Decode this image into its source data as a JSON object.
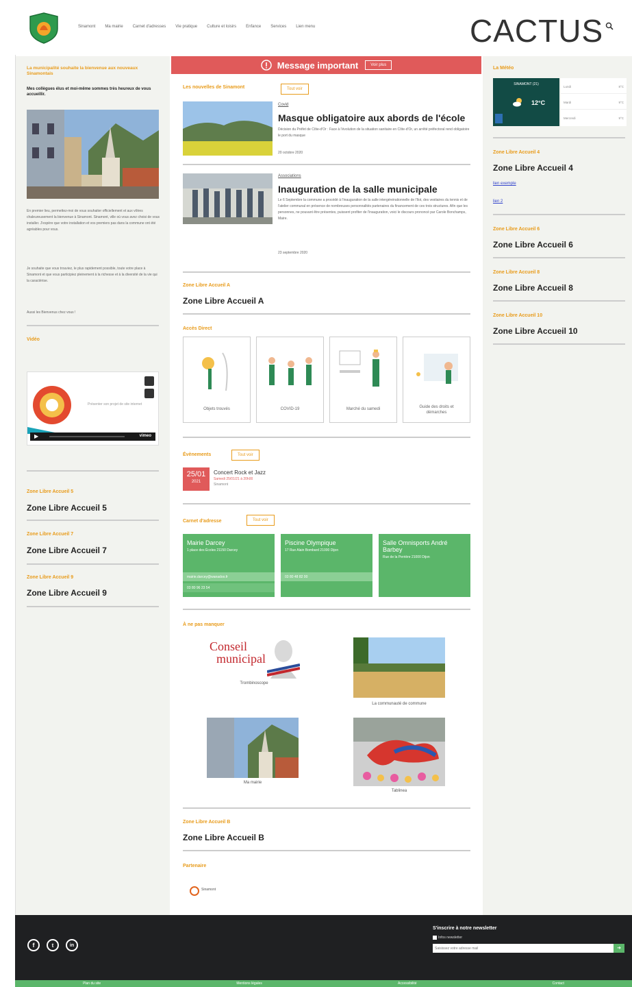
{
  "header": {
    "brand": "CACTUS",
    "nav": [
      "Sinamont",
      "Ma mairie",
      "Carnet d'adresses",
      "Vie pratique",
      "Culture et loisirs",
      "Enfance",
      "Services",
      "Lien menu"
    ]
  },
  "left": {
    "heading": "La municipalité souhaite la bienvenue aux nouveaux Sinamontais",
    "intro": "Mes collègues élus et moi-même sommes très heureux de vous accueillir.",
    "p1": "En premier lieu, permettez-moi de vous souhaiter officiellement et aux vôtres chaleureusement la bienvenue à Sinamont. Sinamont, ville où vous avez choisi de vous installer. J'espère que votre installation et vos premiers pas dans la commune ont été agréables pour vous.",
    "p2": "Je souhaite que vous trouviez, le plus rapidement possible, toute votre place à Sinamont et que vous participiez pleinement à la richesse et à la diversité de la vie qui la caractérise.",
    "p3": "Aussi les Bienvenus chez vous !",
    "video_heading": "Vidéo",
    "video_caption": "Présenter son projet de site internet",
    "zones": [
      {
        "small": "Zone Libre Accueil 5",
        "big": "Zone Libre Accueil 5"
      },
      {
        "small": "Zone Libre Accueil 7",
        "big": "Zone Libre Accueil 7"
      },
      {
        "small": "Zone Libre Accueil 9",
        "big": "Zone Libre Accueil 9"
      }
    ]
  },
  "main": {
    "important_title": "Message important",
    "important_btn": "Voir plus",
    "news_heading": "Les nouvelles de Sinamont",
    "news_btn": "Tout voir",
    "news": [
      {
        "cat": "Covid",
        "title": "Masque obligatoire aux abords de l'école",
        "text": "Décision du Préfet de Côte-d'Or : Face à l'évolution de la situation sanitaire en Côte-d'Or, un arrêté préfectoral rend obligatoire le port du masque",
        "date": "20 octobre 2020"
      },
      {
        "cat": "Associations",
        "title": "Inauguration de la salle municipale",
        "text": "Le 6 Septembre la commune a procédé à l'inauguration de la salle intergénérationnelle de l'Ilot, des vestiaires du tennis et de l'atelier communal en présence de nombreuses personnalités partenaires du financement de ces trois structures. Afin que les personnes, ne pouvant être présentes, puissent profiter de l'inauguration, voici le discours prononcé par Carole Bonchamps, Maire.",
        "date": "23 septembre 2020"
      }
    ],
    "zoneA_small": "Zone Libre Accueil A",
    "zoneA_big": "Zone Libre Accueil A",
    "direct_heading": "Accès Direct",
    "direct": [
      "Objets trouvés",
      "COVID-19",
      "Marché du samedi",
      "Guide des droits et démarches"
    ],
    "events_heading": "Évènements",
    "events_btn": "Tout voir",
    "event": {
      "day": "25/01",
      "year": "2021",
      "title": "Concert Rock et Jazz",
      "time": "Samedi 25/01/21 à 20h00",
      "place": "Sinamont"
    },
    "address_heading": "Carnet d'adresse",
    "address_btn": "Tout voir",
    "addresses": [
      {
        "name": "Mairie Darcey",
        "detail": "1 place des Écoles 21150 Darcey",
        "mail": "mairie.darcey@wanadoo.fr",
        "phone": "03 80 96 23 54"
      },
      {
        "name": "Piscine Olympique",
        "detail": "17 Rue Alain Bombard 21000 Dijon",
        "phone": "03 80 48 82 00"
      },
      {
        "name": "Salle Omnisports André Barbey",
        "detail": "Rue de la Perrière 21000 Dijon"
      }
    ],
    "miss_heading": "À ne pas manquer",
    "miss": [
      "Trombinoscope",
      "La communauté de commune",
      "Ma mairie",
      "Tablinea"
    ],
    "council_line1": "Conseil",
    "council_line2": "municipal",
    "zoneB_small": "Zone Libre Accueil B",
    "zoneB_big": "Zone Libre Accueil B",
    "partners_heading": "Partenaire",
    "partner_name": "Sinamont"
  },
  "right": {
    "weather_heading": "La Météo",
    "weather_city": "SINAMONT (21)",
    "weather_temp": "12°C",
    "weather_days": [
      {
        "day": "Lundi",
        "t": "8°C"
      },
      {
        "day": "Mardi",
        "t": "9°C"
      },
      {
        "day": "Mercredi",
        "t": "9°C"
      }
    ],
    "zones": [
      {
        "small": "Zone Libre Accueil 4",
        "big": "Zone Libre Accueil 4",
        "links": [
          "lien exemple",
          "lien 2"
        ]
      },
      {
        "small": "Zone Libre Accueil 6",
        "big": "Zone Libre Accueil 6"
      },
      {
        "small": "Zone Libre Accueil 8",
        "big": "Zone Libre Accueil 8"
      },
      {
        "small": "Zone Libre Accueil 10",
        "big": "Zone Libre Accueil 10"
      }
    ]
  },
  "footer": {
    "newsletter_title": "S'inscrire à notre newsletter",
    "newsletter_check": "Infos newsletter",
    "newsletter_placeholder": "Saisissez votre adresse mail",
    "links": [
      "Plan du site",
      "Mentions légales",
      "Accessibilité",
      "Contact"
    ]
  },
  "colors": {
    "accent": "#e89b1a",
    "green": "#5bb66a",
    "red": "#e05a5a",
    "footer": "#1f2022"
  }
}
